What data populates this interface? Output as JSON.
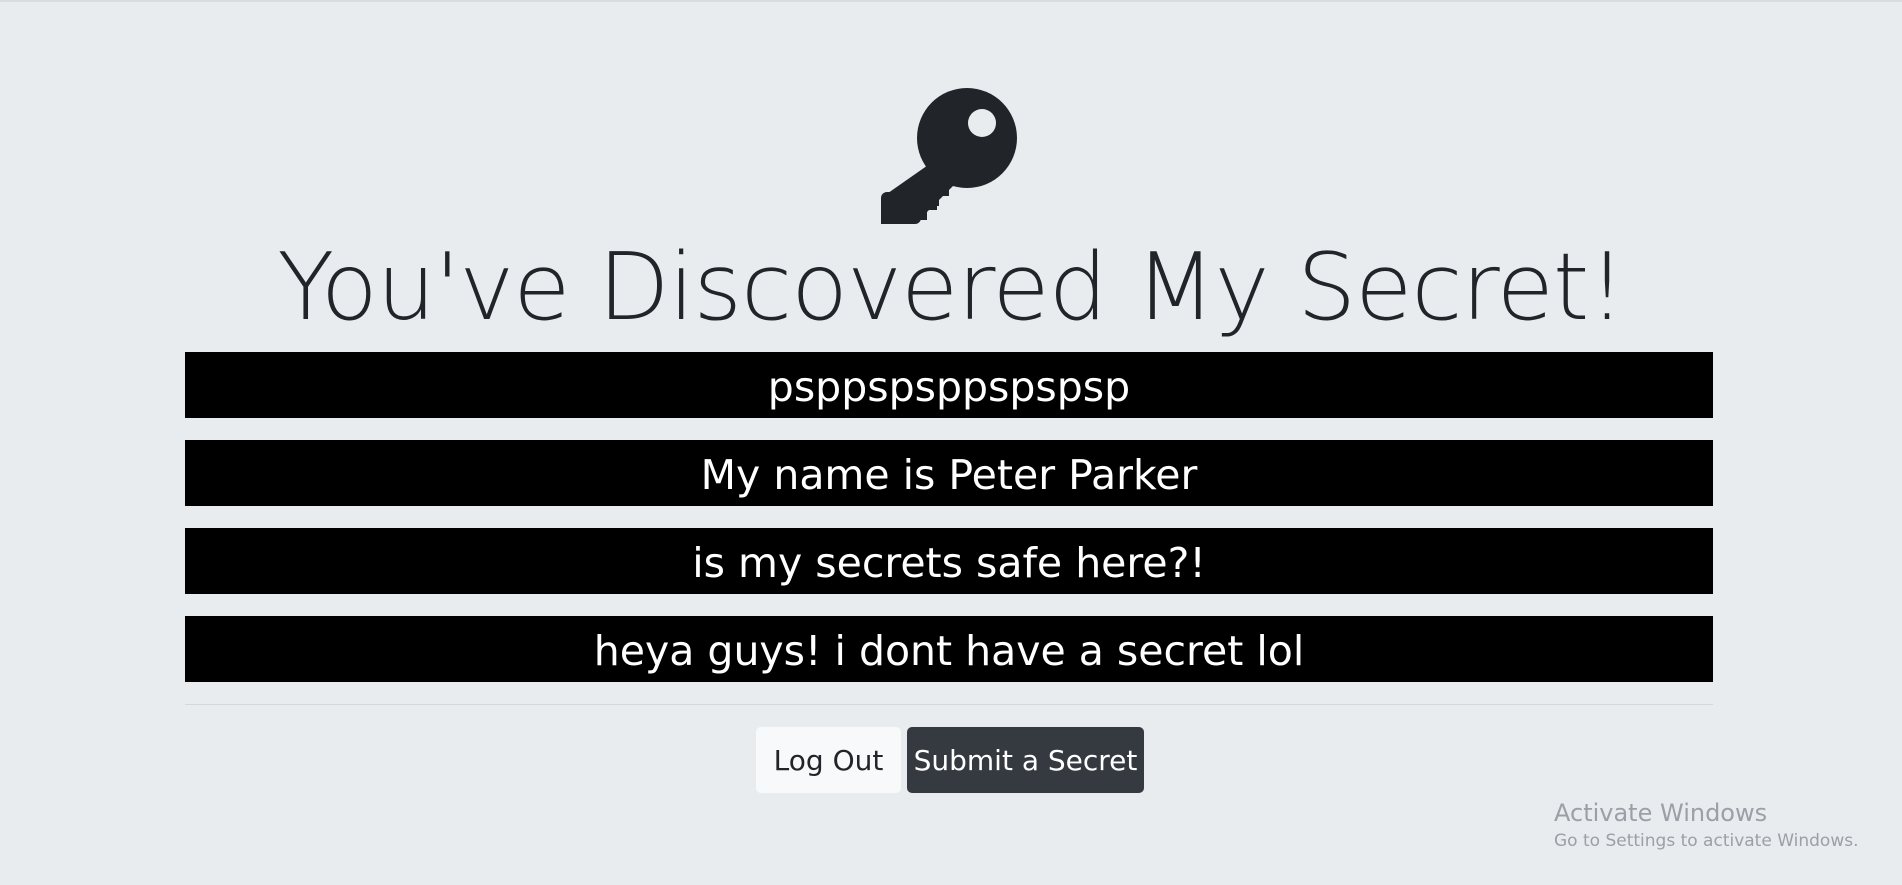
{
  "header": {
    "icon": "key-icon",
    "title": "You've Discovered My Secret!"
  },
  "secrets": [
    "psppspsppspspsp",
    "My name is Peter Parker",
    "is my secrets safe here?!",
    "heya guys! i dont have a secret lol"
  ],
  "actions": {
    "logout_label": "Log Out",
    "submit_label": "Submit a Secret"
  },
  "watermark": {
    "title": "Activate Windows",
    "subtitle": "Go to Settings to activate Windows."
  },
  "colors": {
    "background": "#e9ecef",
    "secret_bg": "#000000",
    "secret_text": "#ffffff",
    "button_light": "#f8f9fa",
    "button_dark": "#343a40",
    "text": "#212529"
  }
}
